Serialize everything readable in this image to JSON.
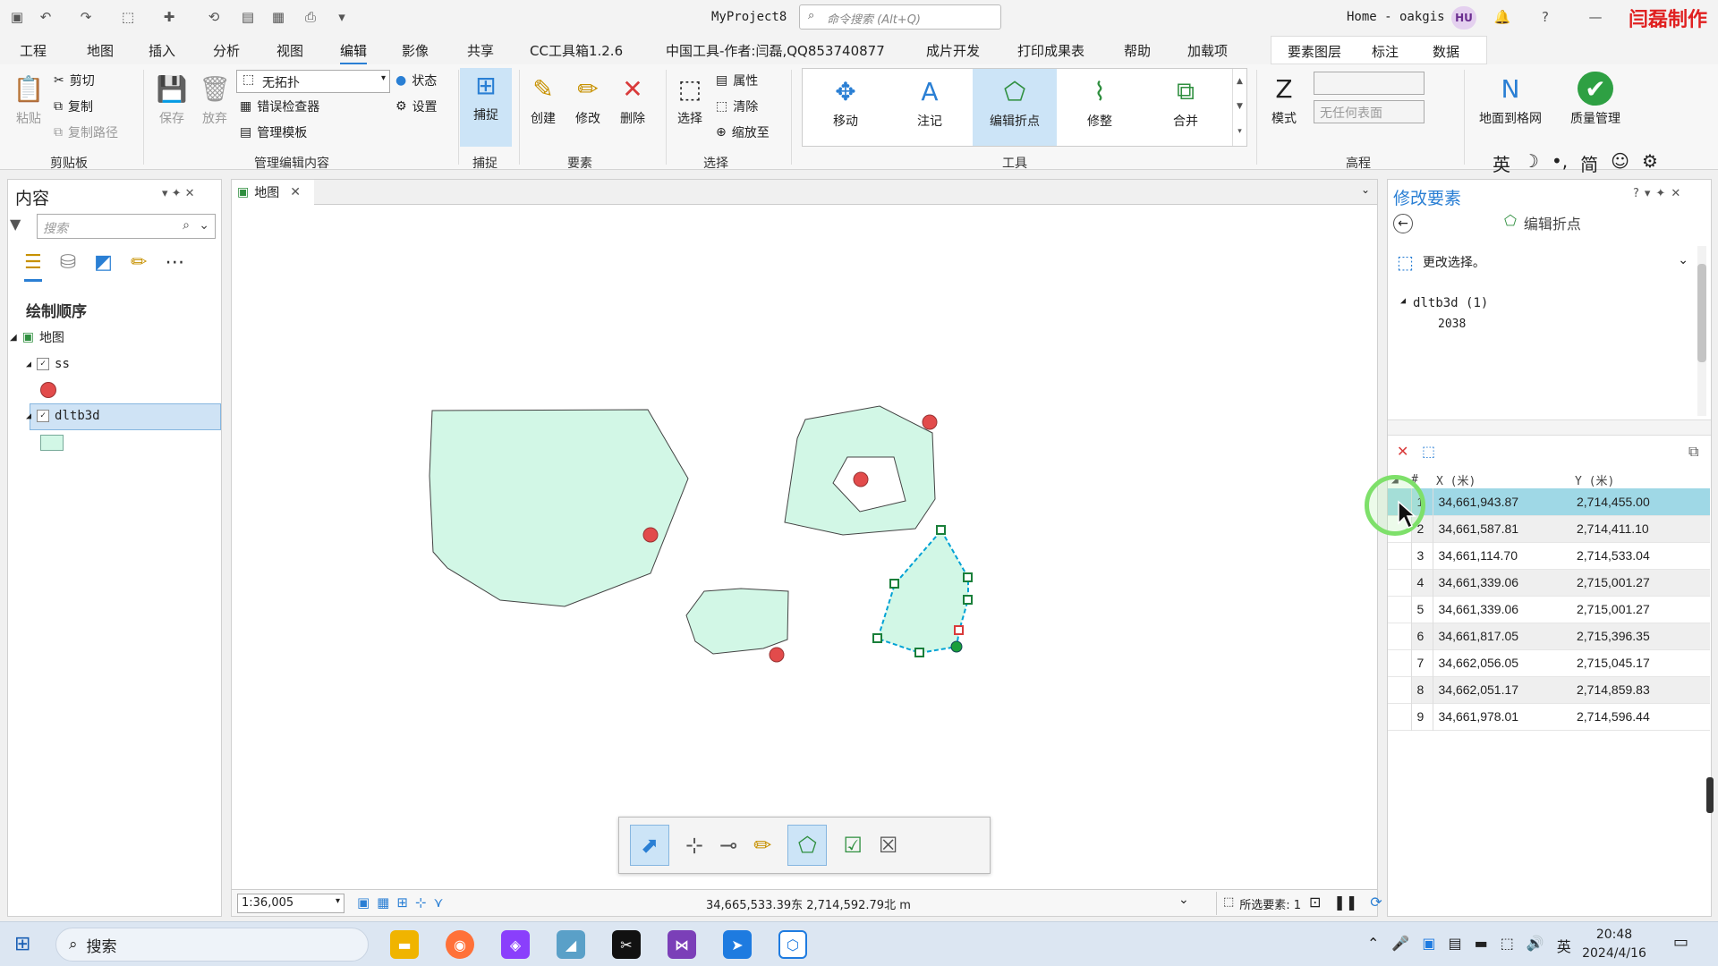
{
  "titlebar": {
    "project": "MyProject8",
    "search_placeholder": "命令搜索 (Alt+Q)",
    "home": "Home - oakgis",
    "avatar": "HU",
    "brand": "闫磊制作"
  },
  "tabs": [
    "工程",
    "地图",
    "插入",
    "分析",
    "视图",
    "编辑",
    "影像",
    "共享",
    "CC工具箱1.2.6",
    "中国工具-作者:闫磊,QQ853740877",
    "成片开发",
    "打印成果表",
    "帮助",
    "加载项"
  ],
  "active_tab": "编辑",
  "context_tabs": [
    "要素图层",
    "标注",
    "数据"
  ],
  "ribbon": {
    "clipboard": {
      "paste": "粘贴",
      "cut": "剪切",
      "copy": "复制",
      "copy_path": "复制路径",
      "group": "剪贴板"
    },
    "manage": {
      "save": "保存",
      "discard": "放弃",
      "topology": "无拓扑",
      "status": "状态",
      "error_inspector": "错误检查器",
      "settings": "设置",
      "manage_templates": "管理模板",
      "group": "管理编辑内容"
    },
    "snapping": {
      "snap": "捕捉",
      "group": "捕捉"
    },
    "features": {
      "create": "创建",
      "modify": "修改",
      "delete": "删除",
      "group": "要素"
    },
    "selection": {
      "select": "选择",
      "attributes": "属性",
      "clear": "清除",
      "zoom_to": "缩放至",
      "group": "选择"
    },
    "tools": {
      "move": "移动",
      "annotate": "注记",
      "edit_vertices": "编辑折点",
      "reshape": "修整",
      "merge": "合并",
      "group": "工具"
    },
    "elevation": {
      "mode": "模式",
      "surface_placeholder": "无任何表面",
      "group": "高程"
    },
    "extra": {
      "ground_to_grid": "地面到格网",
      "quality": "质量管理"
    }
  },
  "ime": [
    "英",
    "☽",
    "•,",
    "简",
    "☺",
    "⚙"
  ],
  "contents": {
    "title": "内容",
    "search_placeholder": "搜索",
    "drawing_order": "绘制顺序",
    "map": "地图",
    "layer1": "ss",
    "layer2": "dltb3d"
  },
  "map_tab": {
    "label": "地图"
  },
  "statusbar": {
    "scale": "1:36,005",
    "coords": "34,665,533.39东  2,714,592.79北 m",
    "selected": "所选要素: 1"
  },
  "modify": {
    "title": "修改要素",
    "tool": "编辑折点",
    "change_selection": "更改选择。",
    "layer": "dltb3d (1)",
    "feature_id": "2038"
  },
  "vertices": {
    "col_num": "#",
    "col_x": "X (米)",
    "col_y": "Y (米)",
    "rows": [
      {
        "n": "1",
        "x": "34,661,943.87",
        "y": "2,714,455.00"
      },
      {
        "n": "2",
        "x": "34,661,587.81",
        "y": "2,714,411.10"
      },
      {
        "n": "3",
        "x": "34,661,114.70",
        "y": "2,714,533.04"
      },
      {
        "n": "4",
        "x": "34,661,339.06",
        "y": "2,715,001.27"
      },
      {
        "n": "5",
        "x": "34,661,339.06",
        "y": "2,715,001.27"
      },
      {
        "n": "6",
        "x": "34,661,817.05",
        "y": "2,715,396.35"
      },
      {
        "n": "7",
        "x": "34,662,056.05",
        "y": "2,715,045.17"
      },
      {
        "n": "8",
        "x": "34,662,051.17",
        "y": "2,714,859.83"
      },
      {
        "n": "9",
        "x": "34,661,978.01",
        "y": "2,714,596.44"
      }
    ]
  },
  "taskbar": {
    "search": "搜索",
    "ime": "英",
    "time": "20:48",
    "date": "2024/4/16"
  },
  "colors": {
    "accent": "#2a7fd4",
    "polygon_fill": "#d2f7e6",
    "point_red": "#e24b4b",
    "selected_row": "#9fd8e6",
    "brand": "#e02020"
  }
}
